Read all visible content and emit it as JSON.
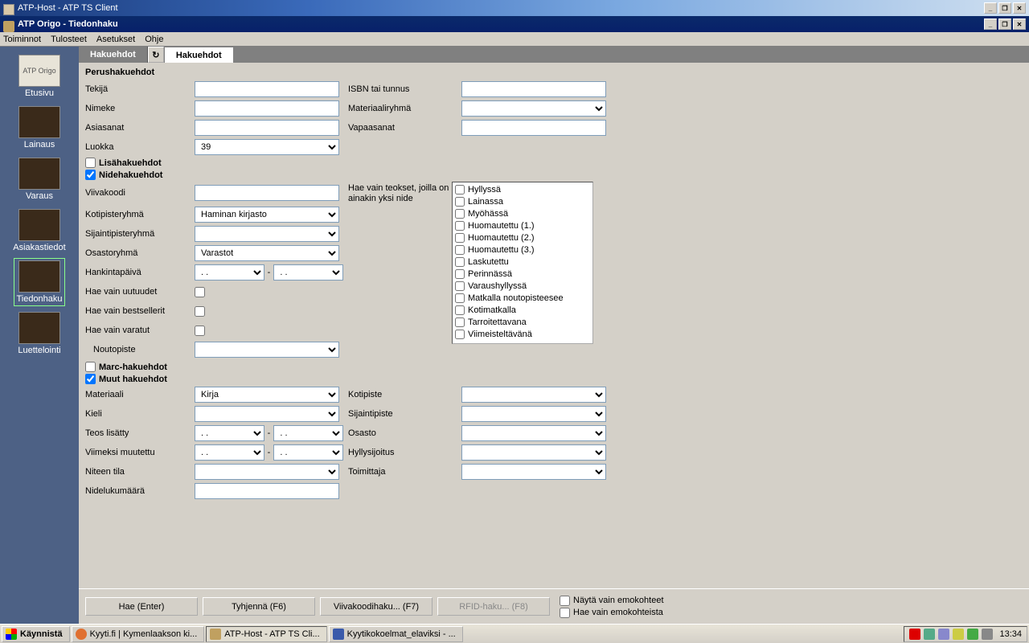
{
  "outer_window": {
    "title": "ATP-Host - ATP TS Client"
  },
  "inner_window": {
    "title": "ATP Origo - Tiedonhaku"
  },
  "menu": [
    "Toiminnot",
    "Tulosteet",
    "Asetukset",
    "Ohje"
  ],
  "sidebar": {
    "items": [
      {
        "label": "Etusivu",
        "icon": "ATP Origo",
        "dark": false
      },
      {
        "label": "Lainaus",
        "icon": "",
        "dark": true
      },
      {
        "label": "Varaus",
        "icon": "",
        "dark": true
      },
      {
        "label": "Asiakastiedot",
        "icon": "",
        "dark": true
      },
      {
        "label": "Tiedonhaku",
        "icon": "",
        "dark": true,
        "active": true
      },
      {
        "label": "Luettelointi",
        "icon": "",
        "dark": true
      }
    ]
  },
  "tabs": {
    "tab1": "Hakuehdot",
    "active": "Hakuehdot"
  },
  "sections": {
    "perus": "Perushakuehdot",
    "lisa": "Lisähakuehdot",
    "nide": "Nidehakuehdot",
    "marc": "Marc-hakuehdot",
    "muut": "Muut hakuehdot"
  },
  "labels": {
    "tekija": "Tekijä",
    "nimeke": "Nimeke",
    "asiasanat": "Asiasanat",
    "luokka": "Luokka",
    "isbn": "ISBN tai tunnus",
    "materiaaliryhma": "Materiaaliryhmä",
    "vapaasanat": "Vapaasanat",
    "viivakoodi": "Viivakoodi",
    "kotipisteryhma": "Kotipisteryhmä",
    "sijaintipisteryhma": "Sijaintipisteryhmä",
    "osastoryhma": "Osastoryhmä",
    "hankintapaiva": "Hankintapäivä",
    "uutuudet": "Hae vain uutuudet",
    "bestsellerit": "Hae vain bestsellerit",
    "varatut": "Hae vain varatut",
    "noutopiste": "Noutopiste",
    "haevain": "Hae vain teokset, joilla on ainakin yksi nide",
    "materiaali": "Materiaali",
    "kieli": "Kieli",
    "teoslisatty": "Teos lisätty",
    "viimeksi": "Viimeksi muutettu",
    "niteentila": "Niteen tila",
    "nidelukumaara": "Nidelukumäärä",
    "kotipiste": "Kotipiste",
    "sijaintipiste": "Sijaintipiste",
    "osasto": "Osasto",
    "hyllysijoitus": "Hyllysijoitus",
    "toimittaja": "Toimittaja"
  },
  "values": {
    "luokka": "39",
    "kotipisteryhma": "Haminan kirjasto",
    "osastoryhma": "Varastot",
    "materiaali": "Kirja",
    "date_placeholder": "  .  .",
    "hankinta_from": "  .  .",
    "hankinta_to": "  .  .",
    "teoslisatty_from": "  .  .",
    "teoslisatty_to": "  .  .",
    "viimeksi_from": "  .  .",
    "viimeksi_to": "  .  ."
  },
  "checks": {
    "lisa": false,
    "nide": true,
    "marc": false,
    "muut": true
  },
  "status_options": [
    "Hyllyssä",
    "Lainassa",
    "Myöhässä",
    "Huomautettu (1.)",
    "Huomautettu (2.)",
    "Huomautettu (3.)",
    "Laskutettu",
    "Perinnässä",
    "Varaushyllyssä",
    "Matkalla noutopisteesee",
    "Kotimatkalla",
    "Tarroitettavana",
    "Viimeisteltävänä"
  ],
  "buttons": {
    "hae": "Hae (Enter)",
    "tyhjenna": "Tyhjennä (F6)",
    "viivakoodi": "Viivakoodihaku... (F7)",
    "rfid": "RFID-haku... (F8)",
    "nayta_emo": "Näytä vain emokohteet",
    "hae_emo": "Hae vain emokohteista"
  },
  "taskbar": {
    "start": "Käynnistä",
    "tasks": [
      "Kyyti.fi | Kymenlaakson ki...",
      "ATP-Host - ATP TS Cli...",
      "Kyytikokoelmat_elaviksi - ..."
    ],
    "clock": "13:34"
  }
}
